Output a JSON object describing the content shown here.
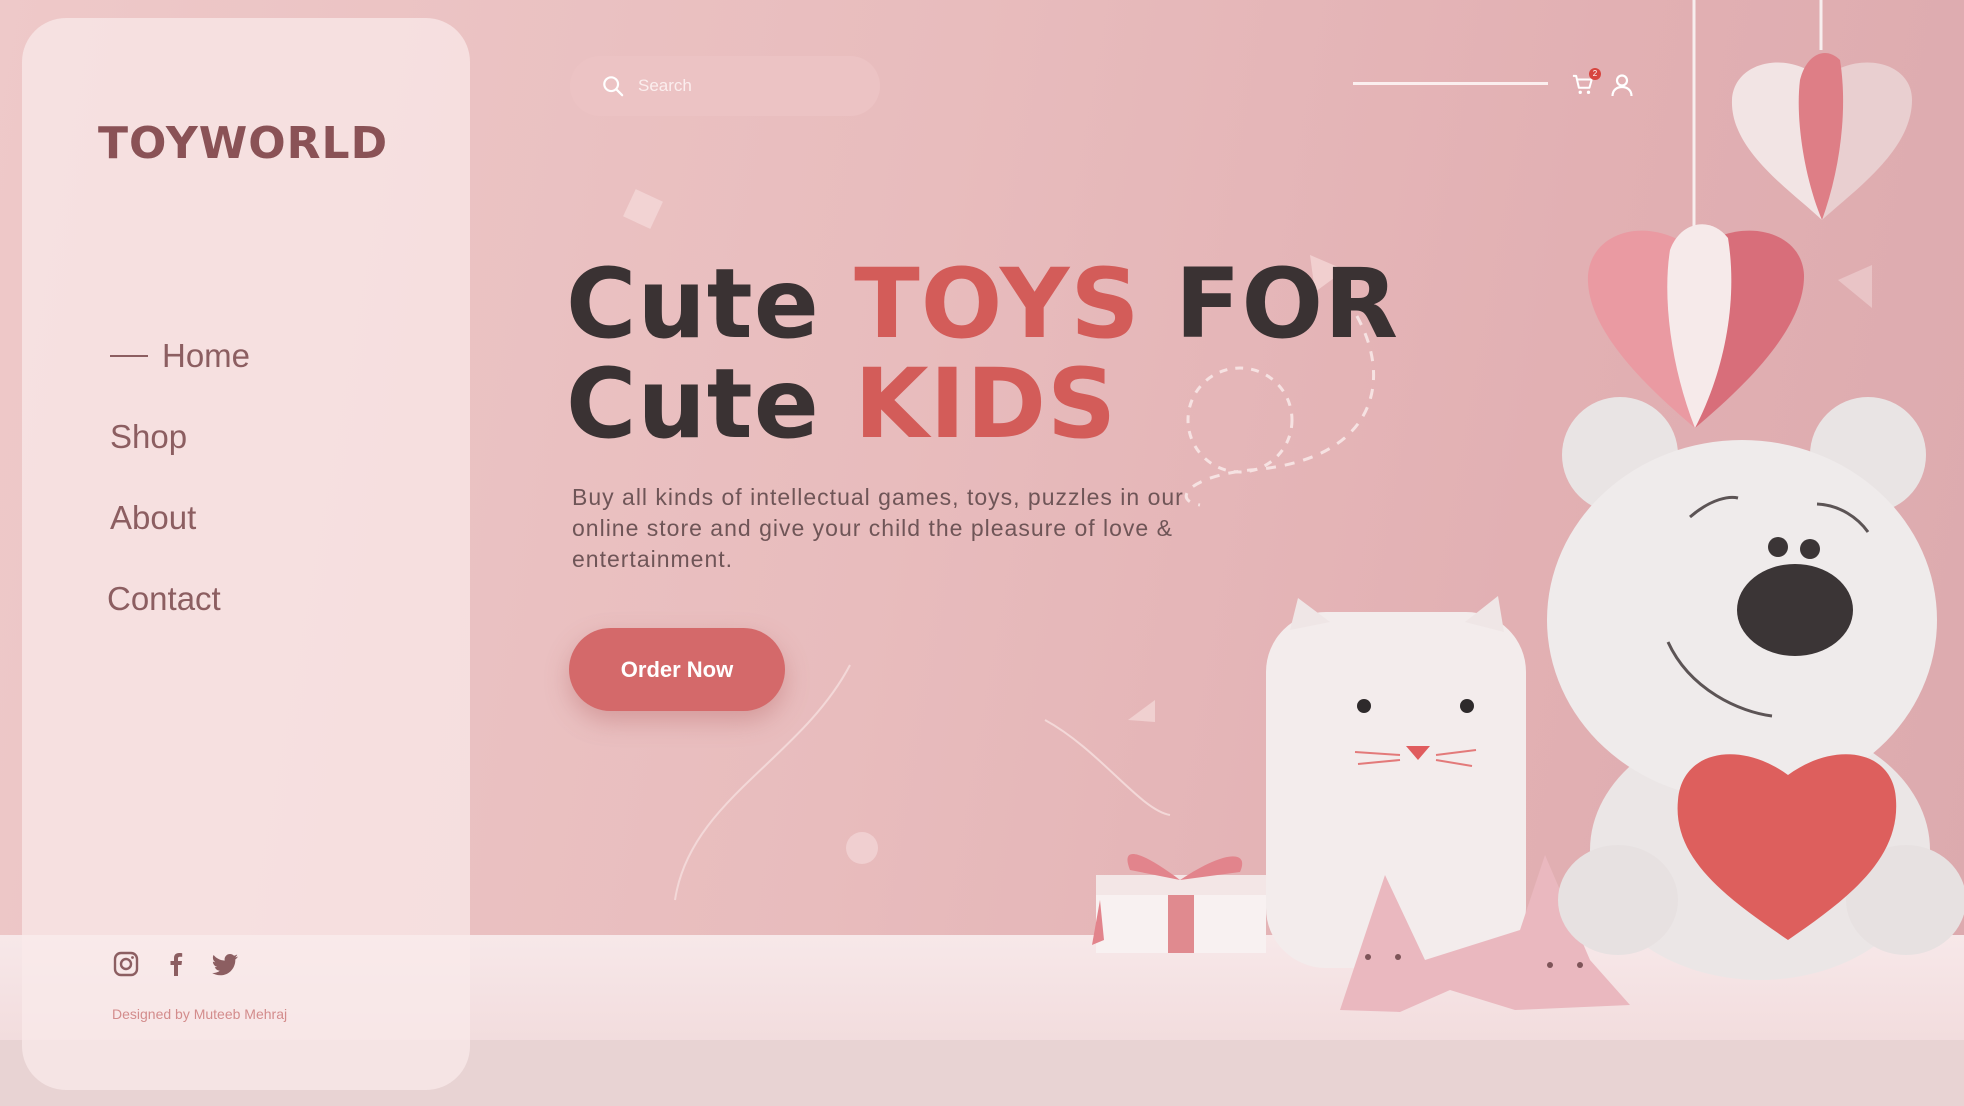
{
  "app": {
    "logo": "TOYWORLD"
  },
  "nav": [
    {
      "label": "Home",
      "active": true
    },
    {
      "label": "Shop",
      "active": false
    },
    {
      "label": "About",
      "active": false
    },
    {
      "label": "Contact",
      "active": false
    }
  ],
  "social": [
    "instagram-icon",
    "facebook-icon",
    "twitter-icon"
  ],
  "credit": "Designed by Muteeb Mehraj",
  "header": {
    "search_placeholder": "Search",
    "cart_count": "2"
  },
  "hero": {
    "line1_a": "Cute ",
    "line1_accent": "TOYS",
    "line1_b": " FOR",
    "line2_a": "Cute ",
    "line2_accent": "KIDS",
    "description": "Buy all kinds of intellectual games, toys, puzzles in our online store and give your child the pleasure of love & entertainment.",
    "cta": "Order Now"
  },
  "colors": {
    "accent": "#d35c59",
    "button": "#d4696a",
    "text_dark": "#3a3233",
    "logo": "#8a5256"
  }
}
